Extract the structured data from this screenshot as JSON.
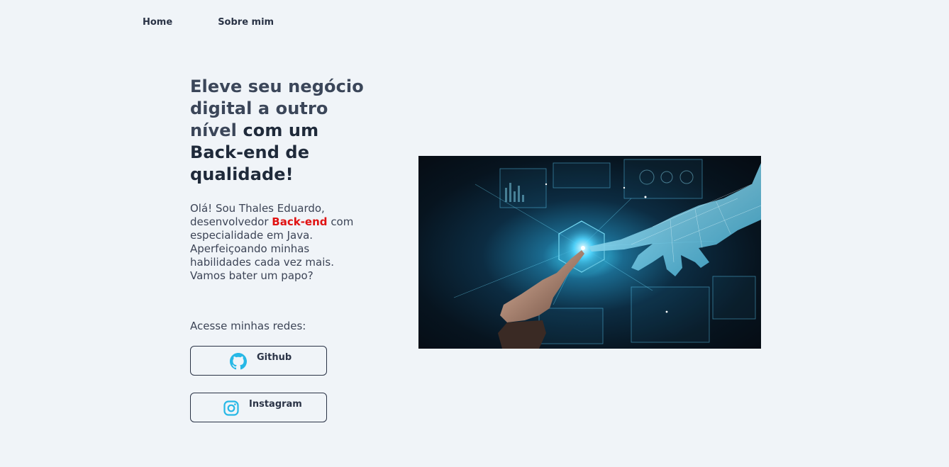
{
  "nav": {
    "home": "Home",
    "about": "Sobre mim"
  },
  "hero": {
    "headline_muted": "Eleve seu negócio digital a outro nível",
    "headline_strong": "com um Back-end de qualidade!",
    "intro_before": "Olá! Sou Thales Eduardo, desenvolvedor",
    "intro_highlight": "Back-end",
    "intro_after": "com especialidade em Java. Aperfeiçoando minhas habilidades cada vez mais. Vamos bater um papo?",
    "highlight_color": "#e01212",
    "networks_label": "Acesse minhas redes:"
  },
  "socials": {
    "github": {
      "label": "Github",
      "icon": "github-icon"
    },
    "instagram": {
      "label": "Instagram",
      "icon": "instagram-icon"
    },
    "icon_color": "#27b8e6"
  },
  "image": {
    "alt": "human-robot-hand-touch",
    "accent": "#3fd9ff"
  }
}
